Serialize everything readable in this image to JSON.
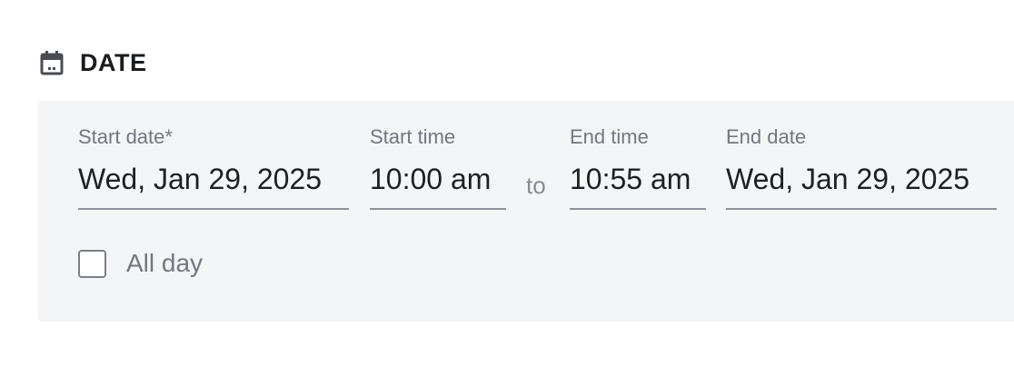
{
  "section": {
    "title": "DATE",
    "icon": "calendar-icon"
  },
  "fields": {
    "start_date": {
      "label": "Start date*",
      "value": "Wed, Jan 29, 2025"
    },
    "start_time": {
      "label": "Start time",
      "value": "10:00 am"
    },
    "separator": "to",
    "end_time": {
      "label": "End time",
      "value": "10:55 am"
    },
    "end_date": {
      "label": "End date",
      "value": "Wed, Jan 29, 2025"
    }
  },
  "all_day": {
    "label": "All day",
    "checked": false
  },
  "colors": {
    "panel_bg": "#f4f5f7",
    "label_gray": "#747680",
    "text_dark": "#1f2024",
    "underline": "#8f9199"
  }
}
